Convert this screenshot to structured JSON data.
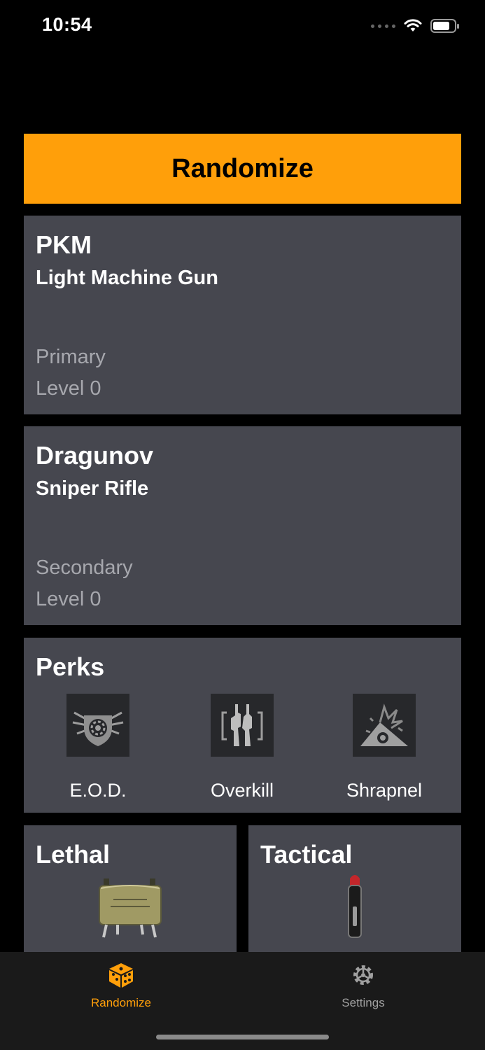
{
  "status": {
    "time": "10:54"
  },
  "randomize_button": {
    "label": "Randomize"
  },
  "primary": {
    "name": "PKM",
    "type": "Light Machine Gun",
    "slot": "Primary",
    "level": "Level 0"
  },
  "secondary": {
    "name": "Dragunov",
    "type": "Sniper Rifle",
    "slot": "Secondary",
    "level": "Level 0"
  },
  "perks": {
    "title": "Perks",
    "items": [
      {
        "label": "E.O.D.",
        "icon": "eod-perk-icon"
      },
      {
        "label": "Overkill",
        "icon": "overkill-perk-icon"
      },
      {
        "label": "Shrapnel",
        "icon": "shrapnel-perk-icon"
      }
    ]
  },
  "lethal": {
    "title": "Lethal",
    "icon": "claymore-icon"
  },
  "tactical": {
    "title": "Tactical",
    "icon": "flare-icon"
  },
  "tabbar": {
    "active_color": "#ff9f0a",
    "inactive_color": "#a0a0a0",
    "items": [
      {
        "label": "Randomize",
        "icon": "dice-icon",
        "active": true
      },
      {
        "label": "Settings",
        "icon": "gear-icon",
        "active": false
      }
    ]
  },
  "colors": {
    "accent": "#ff9f0a",
    "card": "#46474f",
    "background": "#000000"
  }
}
